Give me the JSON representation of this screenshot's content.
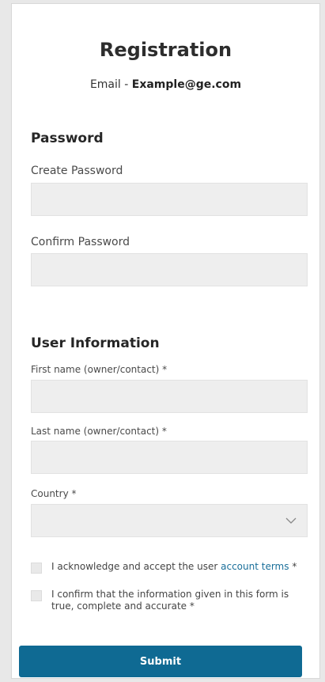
{
  "header": {
    "title": "Registration",
    "email_prefix": "Email - ",
    "email_value": "Example@ge.com"
  },
  "password_section": {
    "heading": "Password",
    "create_label": "Create Password",
    "create_value": "",
    "confirm_label": "Confirm Password",
    "confirm_value": ""
  },
  "user_section": {
    "heading": "User Information",
    "first_name_label": "First name (owner/contact) *",
    "first_name_value": "",
    "last_name_label": "Last name (owner/contact) *",
    "last_name_value": "",
    "country_label": "Country *",
    "country_value": ""
  },
  "checks": {
    "terms_pre": "I acknowledge and accept the user ",
    "terms_link": "account terms",
    "terms_post": " *",
    "confirm_text": "I confirm that the information given in this form is true, complete and accurate *"
  },
  "submit_label": "Submit",
  "colors": {
    "primary": "#0f6a93",
    "link": "#1a6f9a",
    "field_bg": "#eeeeee"
  }
}
